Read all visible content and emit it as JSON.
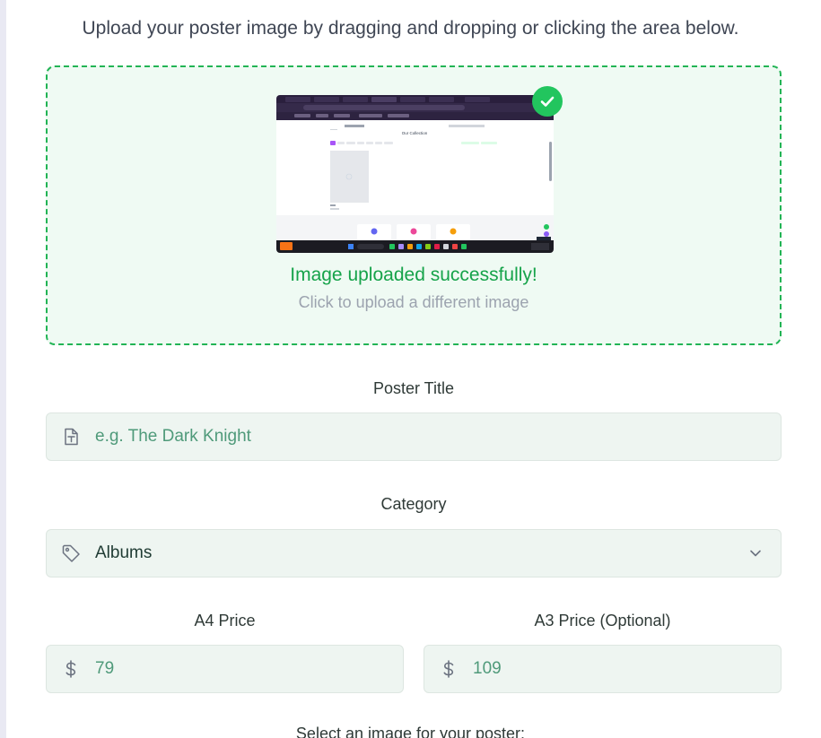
{
  "instructions": "Upload your poster image by dragging and dropping or clicking the area below.",
  "upload": {
    "success_message": "Image uploaded successfully!",
    "reupload_hint": "Click to upload a different image",
    "preview_heading": "Our Collection"
  },
  "form": {
    "title_label": "Poster Title",
    "title_placeholder": "e.g. The Dark Knight",
    "category_label": "Category",
    "category_value": "Albums",
    "a4_label": "A4 Price",
    "a4_placeholder": "79",
    "a3_label": "A3 Price (Optional)",
    "a3_placeholder": "109",
    "image_select_label": "Select an image for your poster:"
  },
  "colors": {
    "accent": "#22c55e",
    "success_text": "#16a34a",
    "input_bg": "#eef5f1",
    "dropzone_bg": "#effaf3"
  },
  "icons": {
    "check": "check-icon",
    "title_field": "text-document-icon",
    "category_field": "tag-icon",
    "dropdown": "chevron-down-icon",
    "price": "dollar-icon"
  }
}
